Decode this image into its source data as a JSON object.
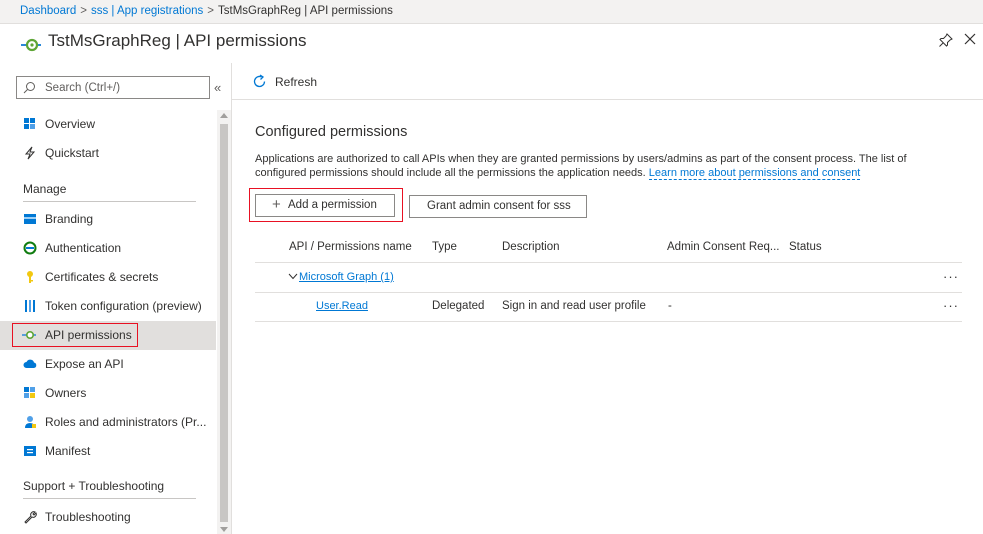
{
  "breadcrumb": {
    "items": [
      "Dashboard",
      "sss | App registrations",
      "TstMsGraphReg | API permissions"
    ],
    "separator": ">"
  },
  "header": {
    "title": "TstMsGraphReg | API permissions"
  },
  "sidebar": {
    "search_placeholder": "Search (Ctrl+/)",
    "collapse_glyph": "«",
    "items_top": [
      {
        "label": "Overview",
        "icon": "overview-grid-icon"
      },
      {
        "label": "Quickstart",
        "icon": "quickstart-lightning-icon"
      }
    ],
    "manage_header": "Manage",
    "manage_items": [
      {
        "label": "Branding",
        "icon": "branding-icon"
      },
      {
        "label": "Authentication",
        "icon": "authentication-icon"
      },
      {
        "label": "Certificates & secrets",
        "icon": "key-icon"
      },
      {
        "label": "Token configuration (preview)",
        "icon": "token-bars-icon"
      },
      {
        "label": "API permissions",
        "icon": "api-permissions-icon",
        "selected": true
      },
      {
        "label": "Expose an API",
        "icon": "cloud-icon"
      },
      {
        "label": "Owners",
        "icon": "owners-icon"
      },
      {
        "label": "Roles and administrators (Pr...",
        "icon": "roles-icon"
      },
      {
        "label": "Manifest",
        "icon": "manifest-icon"
      }
    ],
    "support_header": "Support + Troubleshooting",
    "support_items": [
      {
        "label": "Troubleshooting",
        "icon": "wrench-icon"
      }
    ]
  },
  "toolbar": {
    "refresh_label": "Refresh"
  },
  "main": {
    "section_title": "Configured permissions",
    "description": "Applications are authorized to call APIs when they are granted permissions by users/admins as part of the consent process. The list of configured permissions should include all the permissions the application needs.",
    "learn_more": "Learn more about permissions and consent",
    "add_permission_label": "Add a permission",
    "grant_consent_label": "Grant admin consent for sss",
    "table": {
      "columns": [
        "API / Permissions name",
        "Type",
        "Description",
        "Admin Consent Req...",
        "Status"
      ],
      "group": {
        "label": "Microsoft Graph (1)",
        "more": "···"
      },
      "rows": [
        {
          "name": "User.Read",
          "type": "Delegated",
          "description": "Sign in and read user profile",
          "admin_consent": "-",
          "status": "",
          "more": "···"
        }
      ]
    }
  },
  "colors": {
    "accent": "#0078d4",
    "highlight_border": "#e81123",
    "selected_bg": "#e1dfdd"
  }
}
